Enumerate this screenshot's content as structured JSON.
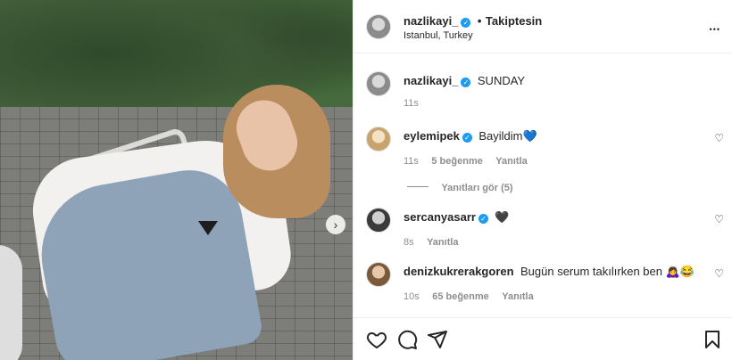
{
  "post": {
    "username": "nazlikayi_",
    "follow_label": "Takiptesin",
    "dot": "•",
    "location": "Istanbul, Turkey",
    "more_label": "•••"
  },
  "caption": {
    "username": "nazlikayi_",
    "text": "SUNDAY",
    "time": "11s"
  },
  "comments": [
    {
      "username": "eylemipek",
      "verified": true,
      "text": "Bayildim💙",
      "time": "11s",
      "likes": "5 beğenme",
      "reply_label": "Yanıtla",
      "view_replies": "Yanıtları gör (5)"
    },
    {
      "username": "sercanyasarr",
      "verified": true,
      "text": "🖤",
      "time": "8s",
      "reply_label": "Yanıtla"
    },
    {
      "username": "denizkukrerakgoren",
      "verified": false,
      "text": "Bugün serum takılırken ben 🙇‍♀️😂",
      "time": "10s",
      "likes": "65 beğenme",
      "reply_label": "Yanıtla"
    }
  ],
  "icons": {
    "verified": "✓",
    "heart": "♡",
    "next": "›"
  },
  "colors": {
    "verified": "#1d9bf0",
    "muted_text": "#8e8e8e",
    "text": "#262626"
  }
}
